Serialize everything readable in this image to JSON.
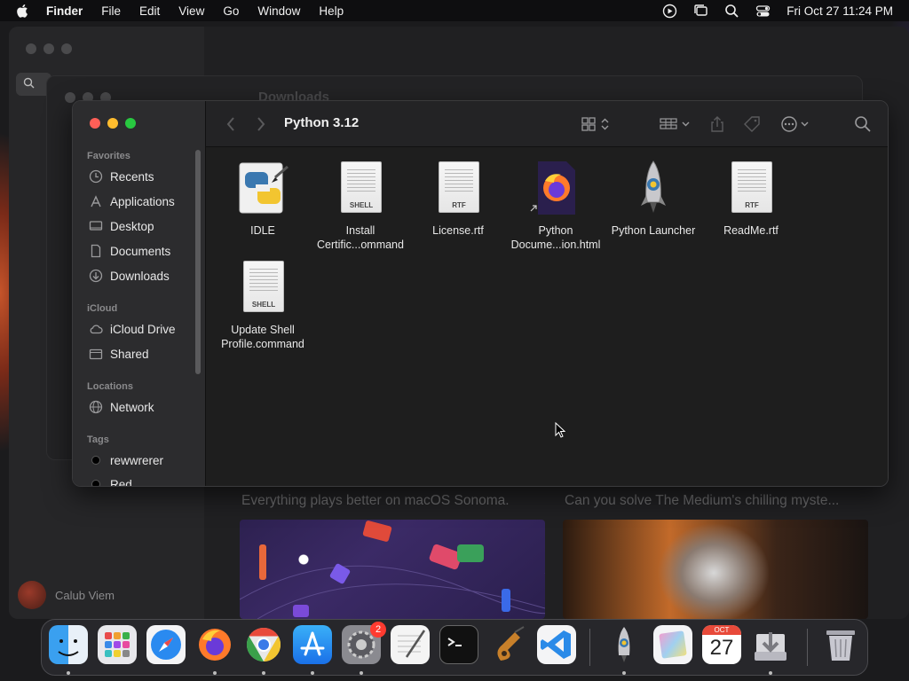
{
  "menubar": {
    "app_name": "Finder",
    "menus": [
      "File",
      "Edit",
      "View",
      "Go",
      "Window",
      "Help"
    ],
    "clock": "Fri Oct 27  11:24 PM"
  },
  "background_app": {
    "window_title": "Downloads",
    "user_name": "Calub Viem",
    "promo_1": "Everything plays better on macOS Sonoma.",
    "promo_2": "Can you solve The Medium's chilling myste..."
  },
  "finder": {
    "title": "Python 3.12",
    "sidebar": {
      "favorites_label": "Favorites",
      "favorites": [
        "Recents",
        "Applications",
        "Desktop",
        "Documents",
        "Downloads"
      ],
      "icloud_label": "iCloud",
      "icloud": [
        "iCloud Drive",
        "Shared"
      ],
      "locations_label": "Locations",
      "locations": [
        "Network"
      ],
      "tags_label": "Tags",
      "tags": [
        "rewwrerer",
        "Red"
      ]
    },
    "files": [
      {
        "name": "IDLE",
        "kind": "idle-app"
      },
      {
        "name": "Install Certific...ommand",
        "kind": "shell",
        "badge": "SHELL"
      },
      {
        "name": "License.rtf",
        "kind": "rtf",
        "badge": "RTF"
      },
      {
        "name": "Python Docume...ion.html",
        "kind": "firefox-html"
      },
      {
        "name": "Python Launcher",
        "kind": "rocket-app"
      },
      {
        "name": "ReadMe.rtf",
        "kind": "rtf",
        "badge": "RTF"
      },
      {
        "name": "Update Shell Profile.command",
        "kind": "shell",
        "badge": "SHELL"
      }
    ]
  },
  "dock": {
    "apps": [
      "Finder",
      "Launchpad",
      "Safari",
      "Firefox",
      "Chrome",
      "App Store",
      "System Settings",
      "TextEdit",
      "Terminal",
      "GarageBand",
      "Visual Studio Code",
      "Python Launcher",
      "Preview",
      "Calendar",
      "Downloads",
      "Trash"
    ],
    "settings_badge": "2",
    "calendar_month": "OCT",
    "calendar_day": "27"
  }
}
